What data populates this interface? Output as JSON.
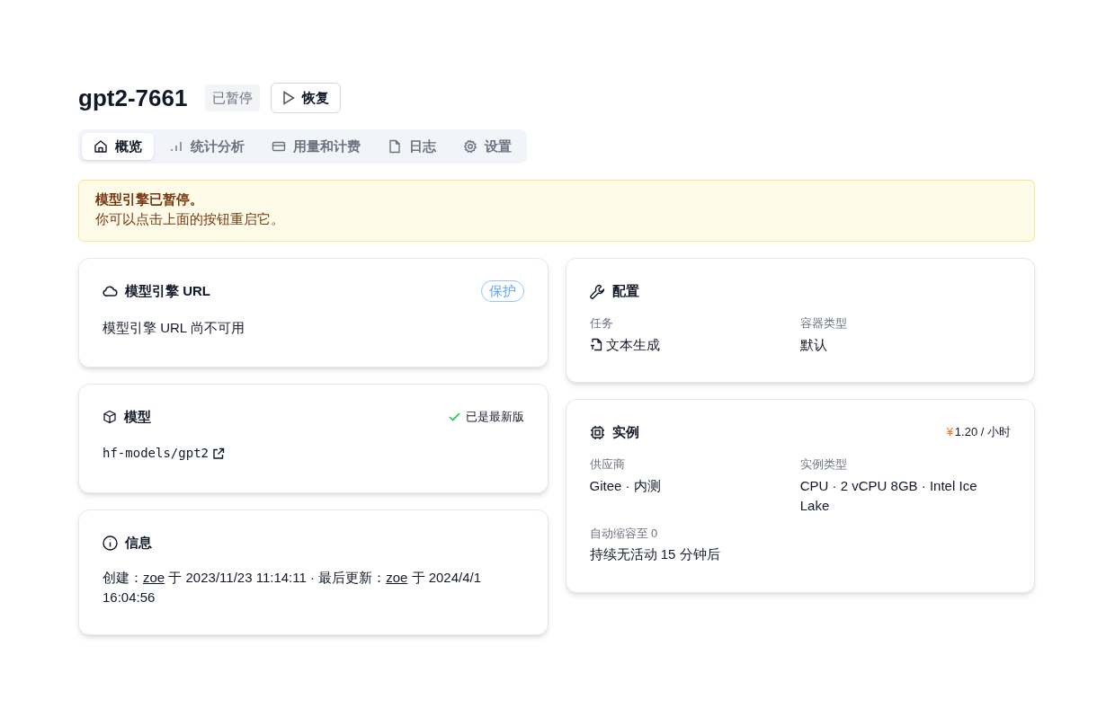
{
  "header": {
    "title": "gpt2-7661",
    "status": "已暂停",
    "action": "恢复"
  },
  "tabs": [
    {
      "label": "概览",
      "selected": true
    },
    {
      "label": "统计分析",
      "selected": false
    },
    {
      "label": "用量和计费",
      "selected": false
    },
    {
      "label": "日志",
      "selected": false
    },
    {
      "label": "设置",
      "selected": false
    }
  ],
  "alert": {
    "title": "模型引擎已暂停。",
    "message": "你可以点击上面的按钮重启它。"
  },
  "endpoint_card": {
    "title": "模型引擎 URL",
    "badge": "保护",
    "body": "模型引擎 URL 尚不可用"
  },
  "model_card": {
    "title": "模型",
    "status": "已是最新版",
    "model": "hf-models/gpt2"
  },
  "info_card": {
    "title": "信息",
    "parts": [
      {
        "kind": "text",
        "text": "创建："
      },
      {
        "kind": "link",
        "text": "zoe"
      },
      {
        "kind": "text",
        "text": " 于 2023/11/23 11:14:11 · 最后更新："
      },
      {
        "kind": "link",
        "text": "zoe"
      },
      {
        "kind": "text",
        "text": " 于 2024/4/1 16:04:56"
      }
    ]
  },
  "config_card": {
    "title": "配置",
    "fields": [
      {
        "label": "任务",
        "value": "文本生成"
      },
      {
        "label": "容器类型",
        "value": "默认"
      }
    ]
  },
  "instance_card": {
    "title": "实例",
    "currency": "¥",
    "price": "1.20 / 小时",
    "fields": [
      {
        "label": "供应商",
        "value": "Gitee · 内测"
      },
      {
        "label": "实例类型",
        "value": "CPU · 2 vCPU 8GB · Intel Ice Lake"
      },
      {
        "label": "自动缩容至 0",
        "value": "持续无活动 15 分钟后"
      }
    ]
  }
}
